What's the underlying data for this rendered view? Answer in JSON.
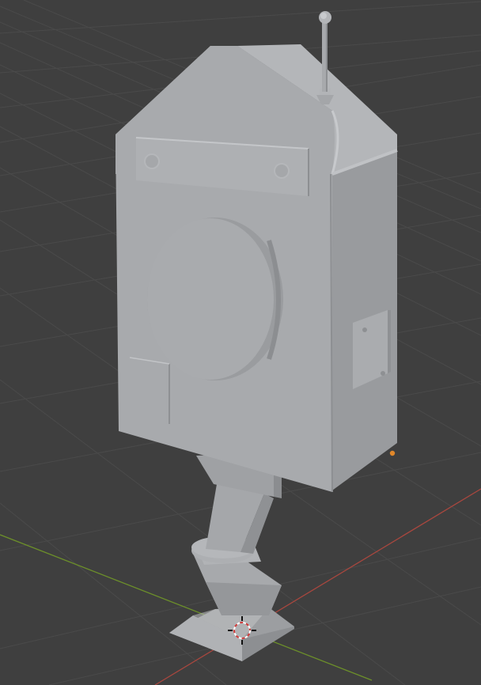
{
  "viewport": {
    "background_color": "#3f3f3f",
    "grid_color": "#4a4a4a",
    "x_axis_color": "#a8473f",
    "y_axis_color": "#6c8f2a",
    "origin_marker_color": "#e0872a"
  },
  "scene": {
    "object_base_color": "#a9abae",
    "object_shadow_color": "#8f9194",
    "object_highlight_color": "#b7b9bc"
  },
  "cursor": {
    "icon": "3d-cursor-icon"
  }
}
